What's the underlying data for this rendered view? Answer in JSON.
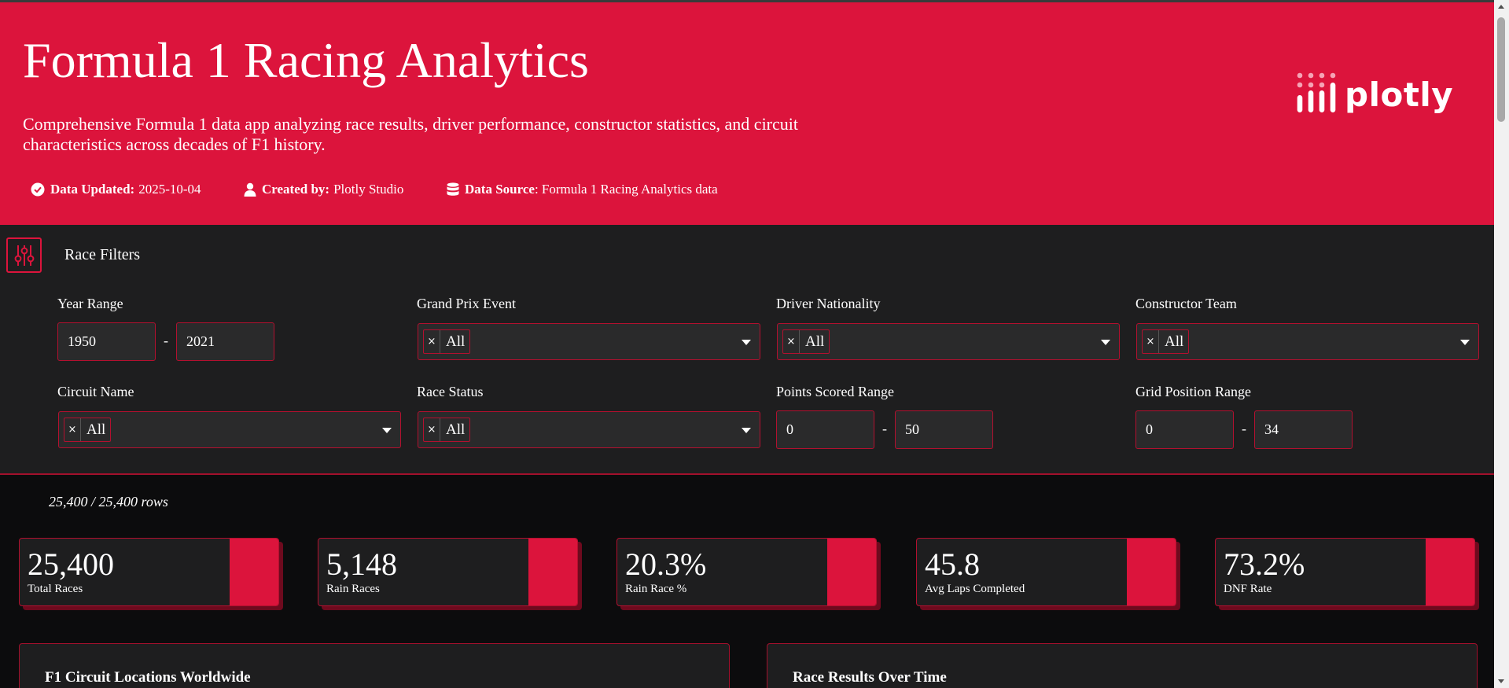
{
  "header": {
    "title": "Formula 1 Racing Analytics",
    "description": "Comprehensive Formula 1 data app analyzing race results, driver performance, constructor statistics, and circuit characteristics across decades of F1 history.",
    "meta": {
      "updated_label": "Data Updated:",
      "updated_value": "2025-10-04",
      "created_label": "Created by:",
      "created_value": "Plotly Studio",
      "source_label": "Data Source",
      "source_value": ": Formula 1 Racing Analytics data"
    },
    "logo_text": "plotly"
  },
  "filters": {
    "title": "Race Filters",
    "year_range": {
      "label": "Year Range",
      "min": "1950",
      "max": "2021",
      "separator": "-"
    },
    "grand_prix": {
      "label": "Grand Prix Event",
      "value": "All",
      "remove": "×"
    },
    "driver_nationality": {
      "label": "Driver Nationality",
      "value": "All",
      "remove": "×"
    },
    "constructor_team": {
      "label": "Constructor Team",
      "value": "All",
      "remove": "×"
    },
    "circuit_name": {
      "label": "Circuit Name",
      "value": "All",
      "remove": "×"
    },
    "race_status": {
      "label": "Race Status",
      "value": "All",
      "remove": "×"
    },
    "points_range": {
      "label": "Points Scored Range",
      "min": "0",
      "max": "50",
      "separator": "-"
    },
    "grid_range": {
      "label": "Grid Position Range",
      "min": "0",
      "max": "34",
      "separator": "-"
    }
  },
  "rows_count": "25,400 / 25,400 rows",
  "kpis": [
    {
      "value": "25,400",
      "label": "Total Races"
    },
    {
      "value": "5,148",
      "label": "Rain Races"
    },
    {
      "value": "20.3%",
      "label": "Rain Race %"
    },
    {
      "value": "45.8",
      "label": "Avg Laps Completed"
    },
    {
      "value": "73.2%",
      "label": "DNF Rate"
    }
  ],
  "panels": {
    "map_title": "F1 Circuit Locations Worldwide",
    "results_title": "Race Results Over Time"
  },
  "colors": {
    "accent": "#dc143c",
    "panel_bg": "#1e1e1f",
    "page_bg": "#0c0c0d"
  },
  "icons": {
    "updated": "check-circle-icon",
    "created": "user-icon",
    "source": "database-icon",
    "filters": "sliders-icon"
  }
}
